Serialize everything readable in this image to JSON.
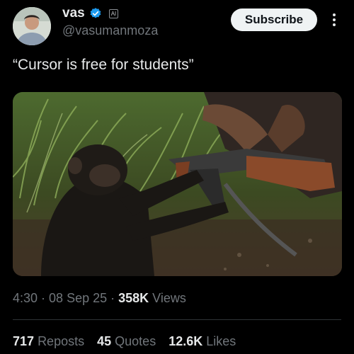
{
  "author": {
    "name": "vas",
    "handle": "@vasumanmoza",
    "badge": "AI",
    "verified_icon": "verified-badge-icon",
    "verified_color": "#1d9bf0"
  },
  "actions": {
    "subscribe_label": "Subscribe",
    "more_icon": "vertical-ellipsis-icon"
  },
  "tweet": {
    "text": "“Cursor is free for students”"
  },
  "meta": {
    "time": "4:30",
    "sep1": " · ",
    "date": "08 Sep 25",
    "sep2": " · ",
    "views_count": "358K",
    "views_label": " Views"
  },
  "stats": {
    "reposts_count": "717",
    "reposts_label": "Reposts",
    "quotes_count": "45",
    "quotes_label": "Quotes",
    "likes_count": "12.6K",
    "likes_label": "Likes"
  }
}
